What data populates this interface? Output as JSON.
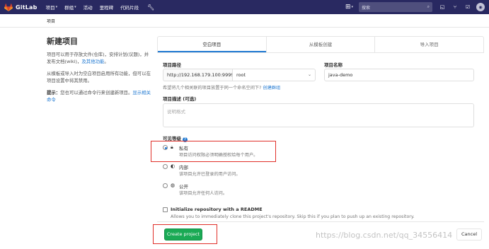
{
  "header": {
    "brand": "GitLab",
    "nav": [
      {
        "label": "项目",
        "dropdown": true
      },
      {
        "label": "群组",
        "dropdown": true
      },
      {
        "label": "活动",
        "dropdown": false
      },
      {
        "label": "里程碑",
        "dropdown": false
      },
      {
        "label": "代码片段",
        "dropdown": false
      }
    ],
    "search_placeholder": "搜索",
    "colors": {
      "bar": "#292961",
      "brand_orange": "#fc6d26"
    }
  },
  "breadcrumb": "项目",
  "sidebar": {
    "title": "新建项目",
    "para1_text": "项目可以用于存放文件(仓库)，安排计划(议题)，并发布文档(wiki)，",
    "para1_link": "及其他功能",
    "para1_end": "。",
    "para2": "从模板或导入时为空白项目启用所有功能，但可以在项目设置中将其禁用。",
    "tip_label": "提示：",
    "tip_text": "您也可以通过命令行来创建新项目。",
    "tip_link": "显示相关命令"
  },
  "tabs": [
    "空白项目",
    "从模板创建",
    "导入项目"
  ],
  "form": {
    "path_label": "项目路径",
    "path_prefix": "http://192.168.179.100:9999/",
    "namespace": "root",
    "name_label": "项目名称",
    "name_value": "java-demo",
    "group_help": "希望将几个相关联的项目放置于同一个命名空间下?",
    "group_help_link": "创建群组",
    "desc_label": "项目描述 (可选)",
    "desc_placeholder": "说明格式",
    "visibility_label": "可见等级",
    "visibility": [
      {
        "icon": "lock-icon",
        "name": "私有",
        "desc": "项目访问权限必须明确授权给每个用户。",
        "selected": true
      },
      {
        "icon": "shield-icon",
        "name": "内部",
        "desc": "该项目允许已登录的用户访问。",
        "selected": false
      },
      {
        "icon": "globe-icon",
        "name": "公开",
        "desc": "该项目允许任何人访问。",
        "selected": false
      }
    ],
    "readme_title": "Initialize repository with a README",
    "readme_desc": "Allows you to immediately clone this project's repository. Skip this if you plan to push up an existing repository.",
    "create_button": "Create project",
    "cancel_button": "Cancel"
  },
  "watermark": "https://blog.csdn.net/qq_34556414"
}
